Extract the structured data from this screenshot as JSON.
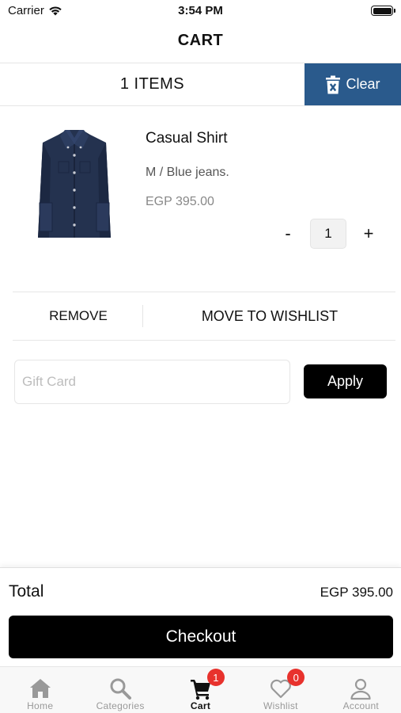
{
  "status_bar": {
    "carrier": "Carrier",
    "time": "3:54 PM"
  },
  "nav": {
    "title": "CART"
  },
  "cart": {
    "items_count": "1 ITEMS",
    "clear_label": "Clear"
  },
  "product": {
    "name": "Casual Shirt",
    "variant": "M / Blue jeans.",
    "price": "EGP 395.00",
    "quantity": "1",
    "minus_label": "-",
    "plus_label": "+"
  },
  "actions": {
    "remove_label": "REMOVE",
    "wishlist_label": "MOVE TO WISHLIST"
  },
  "gift_card": {
    "placeholder": "Gift Card",
    "value": "",
    "apply_label": "Apply"
  },
  "summary": {
    "total_label": "Total",
    "total_value": "EGP 395.00",
    "checkout_label": "Checkout"
  },
  "tabs": [
    {
      "label": "Home",
      "icon": "home-icon",
      "active": false
    },
    {
      "label": "Categories",
      "icon": "search-icon",
      "active": false
    },
    {
      "label": "Cart",
      "icon": "cart-icon",
      "active": true,
      "badge": "1"
    },
    {
      "label": "Wishlist",
      "icon": "heart-icon",
      "active": false,
      "badge": "0"
    },
    {
      "label": "Account",
      "icon": "person-icon",
      "active": false
    }
  ],
  "colors": {
    "clear_bg": "#2a5a8c",
    "badge": "#e8322d",
    "primary": "#000000",
    "tab_inactive": "#999999"
  }
}
